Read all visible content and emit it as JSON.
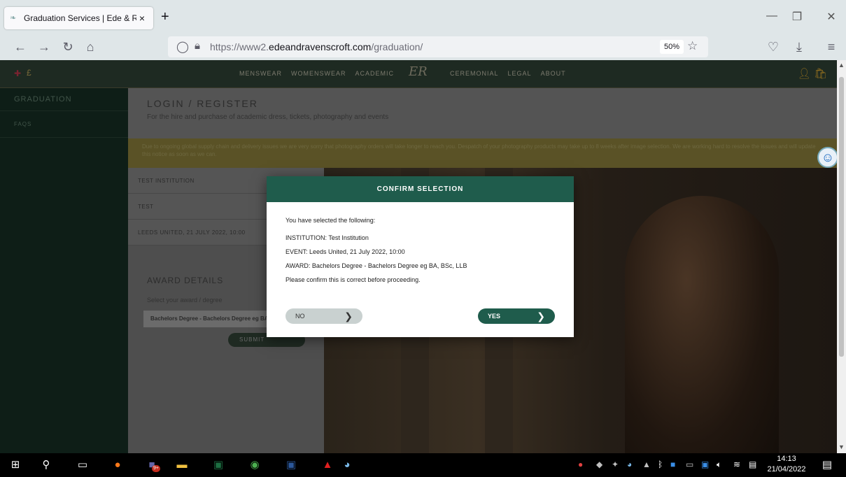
{
  "browser": {
    "tab_title": "Graduation Services | Ede & Rav",
    "url_prefix": "https://www2.",
    "url_domain": "edeandravenscroft.com",
    "url_path": "/graduation/",
    "zoom": "50%"
  },
  "site": {
    "nav": [
      "MENSWEAR",
      "WOMENSWEAR",
      "ACADEMIC",
      "CEREMONIAL",
      "LEGAL",
      "ABOUT"
    ],
    "logo": "ER",
    "currency": "£"
  },
  "sidebar": {
    "items": [
      {
        "label": "GRADUATION"
      },
      {
        "label": "FAQS"
      }
    ]
  },
  "content": {
    "title": "LOGIN / REGISTER",
    "subtitle": "For the hire and purchase of academic dress, tickets, photography and events",
    "notice": "Due to ongoing global supply chain and delivery issues we are very sorry that photography orders will take longer to reach you. Despatch of your photography products may take up to 8 weeks after image selection. We are working hard to resolve the issues and will update this notice as soon as we can.",
    "selection_rows": [
      "TEST INSTITUTION",
      "TEST",
      "LEEDS UNITED, 21 JULY 2022, 10:00"
    ],
    "award_title": "AWARD DETAILS",
    "award_sub": "Select your award / degree",
    "award_value": "Bachelors Degree - Bachelors Degree eg BA, BSc, LLB",
    "submit_label": "SUBMIT"
  },
  "modal": {
    "title": "CONFIRM SELECTION",
    "intro": "You have selected the following:",
    "institution": "INSTITUTION: Test Institution",
    "event": "EVENT: Leeds United, 21 July 2022, 10:00",
    "award": "AWARD: Bachelors Degree - Bachelors Degree eg BA, BSc, LLB",
    "confirm": "Please confirm this is correct before proceeding.",
    "no_label": "NO",
    "yes_label": "YES"
  },
  "taskbar": {
    "time": "14:13",
    "date": "21/04/2022",
    "mail_badge": "9+"
  },
  "colors": {
    "modal_header": "#1f5c4c",
    "yes_button": "#1f5c4c",
    "no_button": "#c9d1d0",
    "notice_band": "#5a5226"
  }
}
